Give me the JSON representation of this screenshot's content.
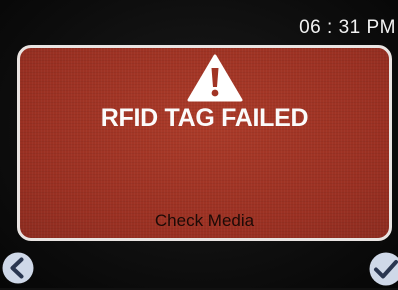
{
  "status_bar": {
    "time": "06 : 31 PM"
  },
  "alert": {
    "icon": "warning-icon",
    "title": "RFID TAG FAILED",
    "message": "Check Media",
    "panel_color": "#a13424",
    "border_color": "#e9e4e2"
  },
  "nav": {
    "back_icon": "chevron-left-icon",
    "confirm_icon": "checkmark-icon",
    "button_color": "#cfd8e8"
  }
}
